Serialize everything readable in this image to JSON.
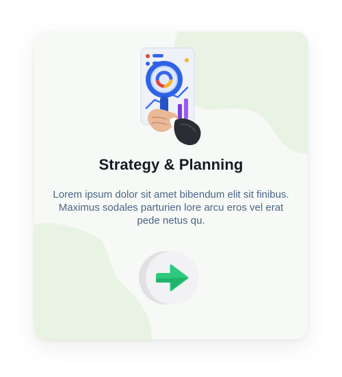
{
  "card": {
    "title": "Strategy & Planning",
    "description": "Lorem ipsum dolor sit amet bibendum elit sit finibus. Maximus sodales parturien lore arcu eros vel erat pede netus qu.",
    "arrow_icon": "arrow-right-icon",
    "illustration_icon": "magnifier-report-hand-icon"
  },
  "colors": {
    "card_bg": "#f7f9f6",
    "blob": "#e9f3e3",
    "title": "#141b23",
    "text": "#4a6585",
    "arrow": "#2ec97c",
    "button_bg": "#f1f0f2"
  }
}
